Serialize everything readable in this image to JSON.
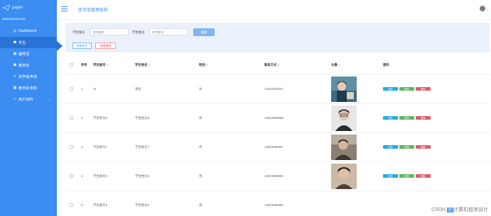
{
  "sidebar": {
    "logo_text": "paper",
    "heading": "MAIN NAVIGATION",
    "items": [
      {
        "label": "Dashboard",
        "icon": "circle-icon"
      },
      {
        "label": "学生",
        "icon": "home-icon"
      },
      {
        "label": "辅导员",
        "icon": "grid-icon"
      },
      {
        "label": "教务处",
        "icon": "home-icon"
      },
      {
        "label": "奖学金申请",
        "icon": "list-icon"
      },
      {
        "label": "教务处审批",
        "icon": "grid-icon"
      },
      {
        "label": "用户资料",
        "icon": "card-icon"
      }
    ]
  },
  "topbar": {
    "title": "奖学金管理系统"
  },
  "search": {
    "account_label": "学生账号",
    "account_placeholder": "学生账号",
    "name_label": "学生姓名",
    "name_placeholder": "学生姓名",
    "search_button": "搜索",
    "add_button": "添加学生",
    "batch_delete_button": "批量删除"
  },
  "table": {
    "headers": [
      "序号",
      "学生账号",
      "学生姓名",
      "性别",
      "联系方式",
      "头像",
      "操作"
    ],
    "rows": [
      {
        "index": "1",
        "account": "11",
        "name": "张岩",
        "gender": "女",
        "phone": "13333333221"
      },
      {
        "index": "2",
        "account": "学生账号8",
        "name": "学生姓名8",
        "gender": "男",
        "phone": "13823888888"
      },
      {
        "index": "3",
        "account": "学生账号7",
        "name": "学生姓名7",
        "gender": "男",
        "phone": "13823888887"
      },
      {
        "index": "4",
        "account": "学生账号6",
        "name": "学生姓名6",
        "gender": "男",
        "phone": "13823888886"
      },
      {
        "index": "5",
        "account": "学生账号5",
        "name": "学生姓名5",
        "gender": "男",
        "phone": "13823888885"
      }
    ],
    "actions": {
      "view": "查看",
      "edit": "修改",
      "delete": "删除"
    }
  },
  "watermark": {
    "prefix": "CSDN",
    "badge": "@",
    "suffix": "计算机程序设计"
  },
  "colors": {
    "primary": "#3b8df2",
    "sidebar_active": "#2a73d6",
    "view": "#24a9e6",
    "edit": "#5cb85c",
    "delete": "#e05a6c"
  }
}
